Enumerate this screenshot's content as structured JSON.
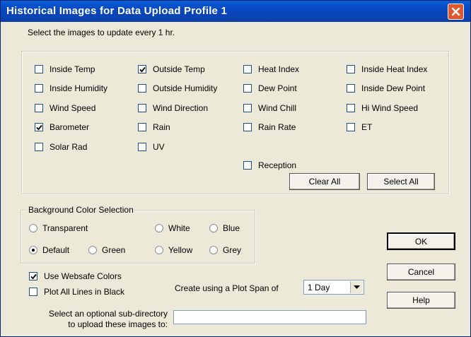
{
  "window": {
    "title": "Historical Images for Data Upload Profile 1"
  },
  "images": {
    "prompt": "Select the images to update every 1 hr.",
    "items": [
      {
        "label": "Inside Temp",
        "checked": false
      },
      {
        "label": "Outside Temp",
        "checked": true
      },
      {
        "label": "Heat Index",
        "checked": false
      },
      {
        "label": "Inside Heat Index",
        "checked": false
      },
      {
        "label": "Inside Humidity",
        "checked": false
      },
      {
        "label": "Outside Humidity",
        "checked": false
      },
      {
        "label": "Dew Point",
        "checked": false
      },
      {
        "label": "Inside Dew Point",
        "checked": false
      },
      {
        "label": "Wind Speed",
        "checked": false
      },
      {
        "label": "Wind Direction",
        "checked": false
      },
      {
        "label": "Wind Chill",
        "checked": false
      },
      {
        "label": "Hi Wind Speed",
        "checked": false
      },
      {
        "label": "Barometer",
        "checked": true
      },
      {
        "label": "Rain",
        "checked": false
      },
      {
        "label": "Rain Rate",
        "checked": false
      },
      {
        "label": "ET",
        "checked": false
      },
      {
        "label": "Solar Rad",
        "checked": false
      },
      {
        "label": "UV",
        "checked": false
      },
      {
        "label": "Reception",
        "checked": false
      }
    ],
    "clear_all": "Clear All",
    "select_all": "Select All"
  },
  "background": {
    "legend": "Background Color Selection",
    "options": [
      {
        "label": "Transparent",
        "selected": false
      },
      {
        "label": "White",
        "selected": false
      },
      {
        "label": "Blue",
        "selected": false
      },
      {
        "label": "Default",
        "selected": true
      },
      {
        "label": "Green",
        "selected": false
      },
      {
        "label": "Yellow",
        "selected": false
      },
      {
        "label": "Grey",
        "selected": false
      }
    ]
  },
  "options": {
    "websafe": {
      "label": "Use Websafe Colors",
      "checked": true
    },
    "black_lines": {
      "label": "Plot All Lines in Black",
      "checked": false
    },
    "plot_span_label": "Create using a Plot Span of",
    "plot_span_value": "1 Day",
    "subdir_label_line1": "Select an optional sub-directory",
    "subdir_label_line2": "to upload these images to:",
    "subdir_value": ""
  },
  "buttons": {
    "ok": "OK",
    "cancel": "Cancel",
    "help": "Help"
  },
  "colors": {
    "titlebar": "#0a52cc",
    "dialog_bg": "#ece9d8",
    "close_button": "#e0562f"
  },
  "icons": {
    "close": "close-icon",
    "check": "checkmark-icon",
    "dropdown": "chevron-down-icon"
  }
}
